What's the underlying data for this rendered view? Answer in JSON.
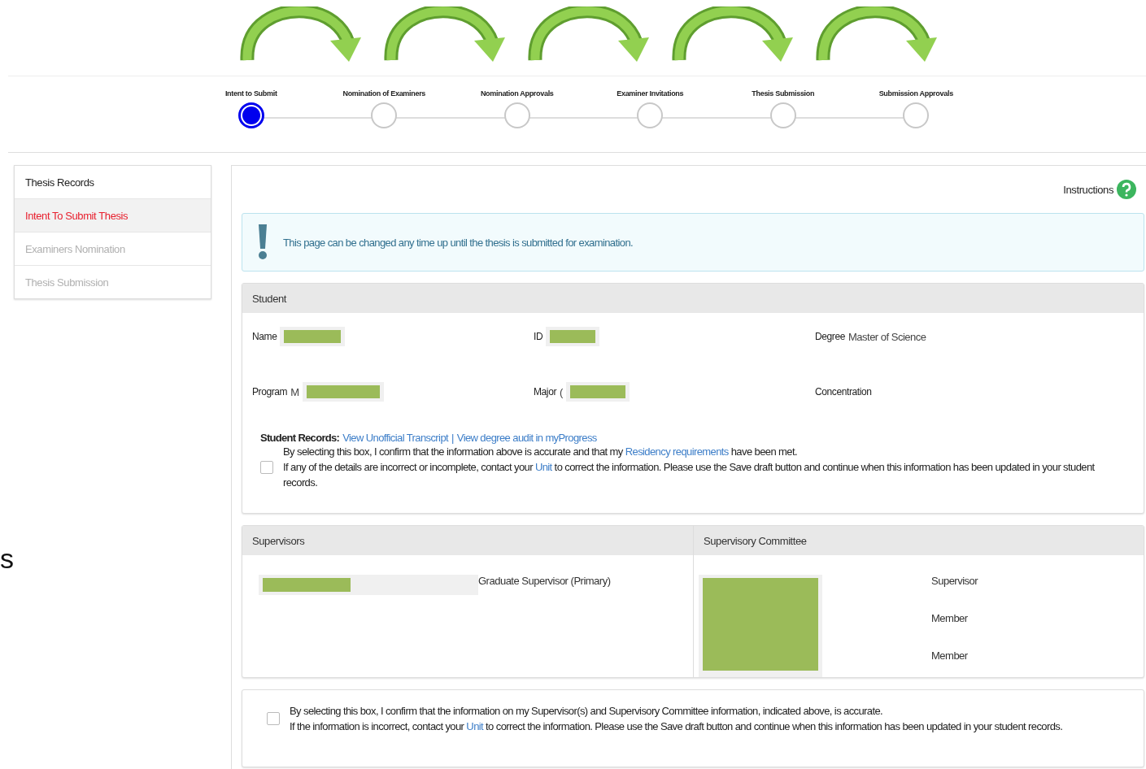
{
  "edge_fragment": "s",
  "stepper": [
    {
      "label": "Intent to Submit",
      "selected": true
    },
    {
      "label": "Nomination of Examiners",
      "selected": false
    },
    {
      "label": "Nomination Approvals",
      "selected": false
    },
    {
      "label": "Examiner Invitations",
      "selected": false
    },
    {
      "label": "Thesis Submission",
      "selected": false
    },
    {
      "label": "Submission Approvals",
      "selected": false
    }
  ],
  "sidebar": {
    "title": "Thesis Records",
    "items": [
      {
        "label": "Intent To Submit Thesis",
        "selected": true,
        "disabled": false
      },
      {
        "label": "Examiners Nomination",
        "selected": false,
        "disabled": true
      },
      {
        "label": "Thesis Submission",
        "selected": false,
        "disabled": true
      }
    ]
  },
  "instructions": "Instructions",
  "alert": "This page can be changed any time up until the thesis is submitted for examination.",
  "student": {
    "title": "Student",
    "fields": [
      {
        "label": "Name",
        "redacted": true
      },
      {
        "label": "ID",
        "redacted": true
      },
      {
        "label": "Degree",
        "value": "Master of Science",
        "redacted": false
      },
      {
        "label": "Program",
        "value": "M",
        "redacted": true
      },
      {
        "label": "Major",
        "value": "(",
        "redacted": true
      },
      {
        "label": "Concentration",
        "redacted": false
      }
    ],
    "records_label": "Student Records:",
    "records_links": [
      "View Unofficial Transcript",
      "View degree audit in myProgress"
    ],
    "records_separator": "|",
    "confirm": {
      "checked": false,
      "lines": [
        [
          {
            "text": "By selecting this box, I confirm that the information above is accurate and that my "
          },
          {
            "text": "Residency requirements",
            "link": true
          },
          {
            "text": " have been met."
          }
        ],
        [
          {
            "text": "If any of the details are incorrect or incomplete, contact your "
          },
          {
            "text": "Unit",
            "link": true
          },
          {
            "text": " to correct the information. Please use the Save draft button and continue when this information has been updated in your student records."
          }
        ]
      ]
    }
  },
  "supervisors": {
    "title": "Supervisors",
    "rows": [
      {
        "redacted": true,
        "role": "Graduate Supervisor (Primary)"
      }
    ]
  },
  "committee": {
    "title": "Supervisory Committee",
    "redacted": true,
    "roles": [
      "Supervisor",
      "Member",
      "Member"
    ]
  },
  "supervisor_confirm": {
    "checked": false,
    "lines": [
      [
        {
          "text": "By selecting this box, I confirm that the information on my Supervisor(s) and Supervisory Committee information, indicated above, is accurate."
        }
      ],
      [
        {
          "text": "If the information is incorrect, contact your "
        },
        {
          "text": "Unit",
          "link": true
        },
        {
          "text": " to correct the information. Please use the Save draft button and continue when this information has been updated in your student records."
        }
      ]
    ]
  }
}
